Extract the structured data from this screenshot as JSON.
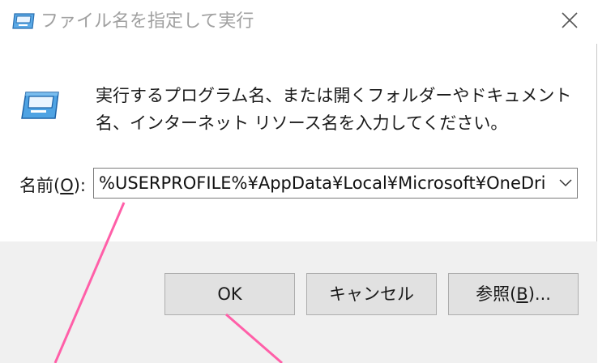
{
  "window": {
    "title": "ファイル名を指定して実行",
    "close_glyph": "✕"
  },
  "prompt": {
    "description": "実行するプログラム名、または開くフォルダーやドキュメント名、インターネット リソース名を入力してください。"
  },
  "open_field": {
    "label_prefix": "名前(",
    "label_accel": "O",
    "label_suffix": "):",
    "value": "%USERPROFILE%¥AppData¥Local¥Microsoft¥OneDri"
  },
  "buttons": {
    "ok": "OK",
    "cancel": "キャンセル",
    "browse_prefix": "参照(",
    "browse_accel": "B",
    "browse_suffix": ")..."
  },
  "icons": {
    "title": "run-dialog-icon",
    "main": "run-program-icon",
    "close": "close-icon",
    "dropdown": "chevron-down-icon"
  },
  "colors": {
    "title_text": "#a0a0a0",
    "button_face": "#e1e1e1",
    "button_bar": "#f0f0f0",
    "annotation_line": "#ff5fa8"
  }
}
